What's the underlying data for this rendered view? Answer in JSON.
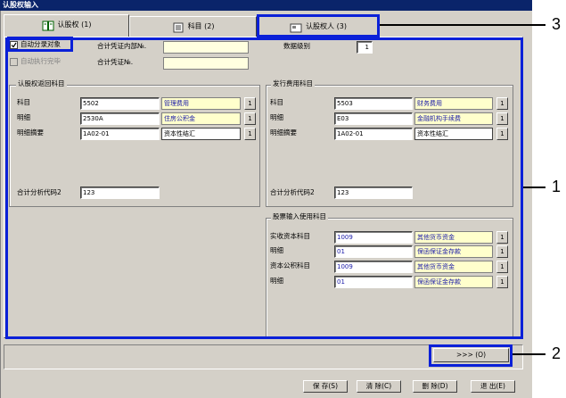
{
  "window": {
    "title": "认股权输入"
  },
  "tabs": [
    {
      "label": "认股权 (1)"
    },
    {
      "label": "科目 (2)"
    },
    {
      "label": "认股权人 (3)"
    }
  ],
  "top": {
    "auto_entry_label": "自动分录对象",
    "auto_exec_label": "自动执行完毕",
    "inner_no_label": "合计凭证内部№.",
    "voucher_no_label": "合计凭证№.",
    "inner_no_value": "",
    "voucher_no_value": "",
    "data_level_label": "数据级别",
    "data_level_value": "1"
  },
  "group_left": {
    "title": "认股权返回科目",
    "rows": [
      {
        "label": "科目",
        "code": "5502",
        "desc": "管理费用"
      },
      {
        "label": "明细",
        "code": "2530A",
        "desc": "住房公积金"
      },
      {
        "label": "明细摘要",
        "code": "1A02-01",
        "desc": "资本性结汇"
      }
    ],
    "analysis_label": "合计分析代码2",
    "analysis_value": "123"
  },
  "group_right": {
    "title": "发行费用科目",
    "rows": [
      {
        "label": "科目",
        "code": "5503",
        "desc": "财务费用"
      },
      {
        "label": "明细",
        "code": "E03",
        "desc": "金融机构手续费"
      },
      {
        "label": "明细摘要",
        "code": "1A02-01",
        "desc": "资本性结汇"
      }
    ],
    "analysis_label": "合计分析代码2",
    "analysis_value": "123"
  },
  "group_stock": {
    "title": "股票输入使用科目",
    "rows": [
      {
        "label": "实收资本科目",
        "code": "1009",
        "desc": "其他货币资金"
      },
      {
        "label": "明细",
        "code": "01",
        "desc": "保函保证金存款"
      },
      {
        "label": "资本公积科目",
        "code": "1009",
        "desc": "其他货币资金"
      },
      {
        "label": "明细",
        "code": "01",
        "desc": "保函保证金存款"
      }
    ]
  },
  "lookup_btn": "1",
  "next_btn": ">>> (O)",
  "buttons": {
    "save": "保 存(S)",
    "clear": "清 除(C)",
    "delete": "删 除(D)",
    "exit": "退 出(E)"
  },
  "callouts": [
    "1",
    "2",
    "3"
  ],
  "colors": {
    "title_bar": "#0a246a",
    "callout": "#0a20d8",
    "face": "#d4d0c8",
    "desc_text": "#1a1aa8"
  }
}
